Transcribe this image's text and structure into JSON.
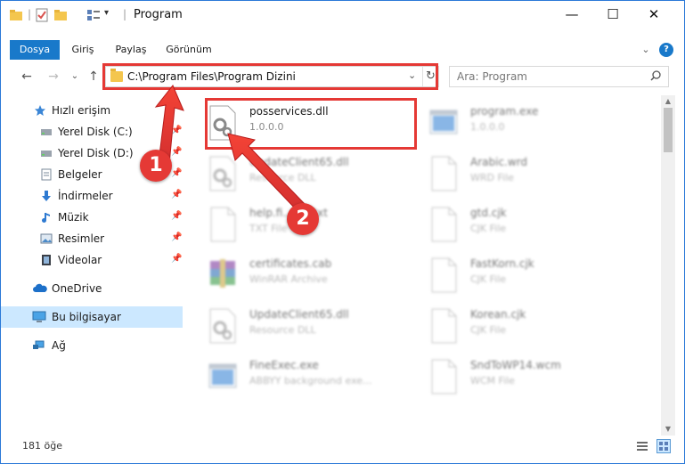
{
  "window": {
    "title": "Program",
    "minimize_glyph": "—",
    "maximize_glyph": "☐",
    "close_glyph": "✕"
  },
  "ribbon": {
    "tabs": [
      "Dosya",
      "Giriş",
      "Paylaş",
      "Görünüm"
    ],
    "active_tab": "Dosya",
    "accent_color": "#1979ca",
    "expand_glyph": "⌄",
    "help_glyph": "?"
  },
  "nav": {
    "back_glyph": "←",
    "forward_glyph": "→",
    "recent_glyph": "⌄",
    "up_glyph": "↑"
  },
  "address": {
    "path": "C:\\Program Files\\Program Dizini",
    "dropdown_glyph": "⌄",
    "refresh_glyph": "↻"
  },
  "search": {
    "placeholder": "Ara: Program"
  },
  "sidebar": {
    "items": [
      {
        "label": "Hızlı erişim",
        "icon": "star-icon",
        "pinned": false
      },
      {
        "label": "Yerel Disk (C:)",
        "icon": "drive-icon",
        "pinned": true
      },
      {
        "label": "Yerel Disk (D:)",
        "icon": "drive-icon",
        "pinned": true
      },
      {
        "label": "Belgeler",
        "icon": "documents-icon",
        "pinned": true
      },
      {
        "label": "İndirmeler",
        "icon": "download-icon",
        "pinned": true
      },
      {
        "label": "Müzik",
        "icon": "music-icon",
        "pinned": true
      },
      {
        "label": "Resimler",
        "icon": "pictures-icon",
        "pinned": true
      },
      {
        "label": "Videolar",
        "icon": "video-icon",
        "pinned": true
      },
      {
        "label": "OneDrive",
        "icon": "cloud-icon",
        "pinned": false
      },
      {
        "label": "Bu bilgisayar",
        "icon": "computer-icon",
        "pinned": false,
        "selected": true
      },
      {
        "label": "Ağ",
        "icon": "network-icon",
        "pinned": false
      }
    ],
    "pin_glyph": "📌"
  },
  "files": [
    {
      "name": "posservices.dll",
      "type": "1.0.0.0",
      "icon": "dll-icon",
      "highlighted": true
    },
    {
      "name": "program.exe",
      "type": "1.0.0.0",
      "icon": "exe-icon"
    },
    {
      "name": "UpdateClient65.dll",
      "type": "Resource DLL",
      "icon": "dll-icon"
    },
    {
      "name": "Arabic.wrd",
      "type": "WRD File",
      "icon": "file-icon"
    },
    {
      "name": "help.fi...der.txt",
      "type": "TXT File",
      "icon": "file-icon"
    },
    {
      "name": "gtd.cjk",
      "type": "CJK File",
      "icon": "file-icon"
    },
    {
      "name": "certificates.cab",
      "type": "WinRAR Archive",
      "icon": "archive-icon"
    },
    {
      "name": "FastKorn.cjk",
      "type": "CJK File",
      "icon": "file-icon"
    },
    {
      "name": "UpdateClient65.dll",
      "type": "Resource DLL",
      "icon": "dll-icon"
    },
    {
      "name": "Korean.cjk",
      "type": "CJK File",
      "icon": "file-icon"
    },
    {
      "name": "FineExec.exe",
      "type": "ABBYY background exe...",
      "icon": "exe-icon"
    },
    {
      "name": "SndToWP14.wcm",
      "type": "WCM File",
      "icon": "file-icon"
    }
  ],
  "status": {
    "item_count": "181 öğe"
  },
  "annotations": {
    "step1": "1",
    "step2": "2",
    "color": "#e53935"
  }
}
